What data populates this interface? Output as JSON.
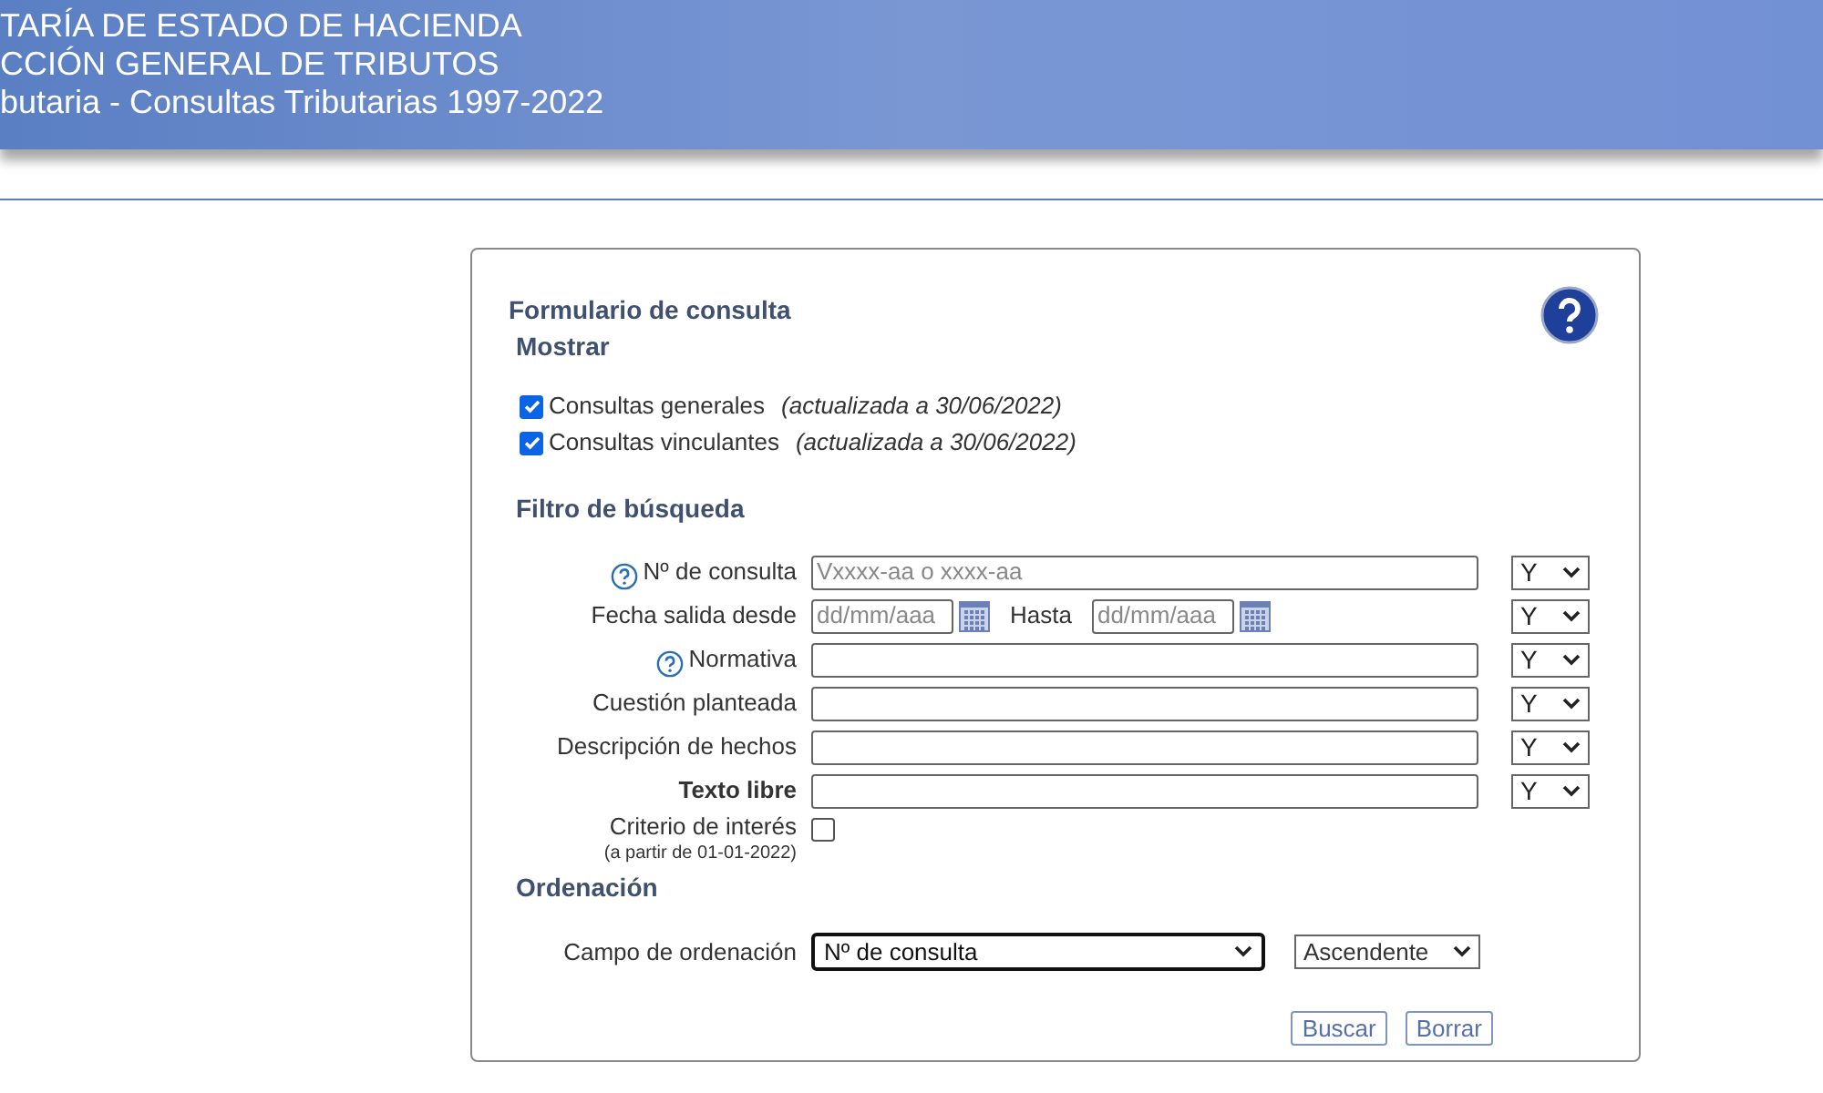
{
  "header": {
    "lines": [
      "TARÍA DE ESTADO DE HACIENDA",
      "CCIÓN GENERAL DE TRIBUTOS",
      "butaria - Consultas Tributarias 1997-2022"
    ]
  },
  "form": {
    "title": "Formulario de consulta",
    "show": {
      "heading": "Mostrar",
      "options": [
        {
          "label": "Consultas generales",
          "note": "(actualizada a 30/06/2022)",
          "checked": true
        },
        {
          "label": "Consultas vinculantes",
          "note": "(actualizada a 30/06/2022)",
          "checked": true
        }
      ]
    },
    "filter": {
      "heading": "Filtro de búsqueda",
      "fields": [
        {
          "kind": "text",
          "label": "Nº de consulta",
          "help": true,
          "bold": false,
          "placeholder": "Vxxxx-aa o xxxx-aa",
          "operator": "Y"
        },
        {
          "kind": "date",
          "label": "Fecha salida desde",
          "help": false,
          "bold": false,
          "placeholder": "dd/mm/aaa",
          "to_label": "Hasta",
          "to_placeholder": "dd/mm/aaa",
          "operator": "Y"
        },
        {
          "kind": "text",
          "label": "Normativa",
          "help": true,
          "bold": false,
          "operator": "Y"
        },
        {
          "kind": "text",
          "label": "Cuestión planteada",
          "help": false,
          "bold": false,
          "operator": "Y"
        },
        {
          "kind": "text",
          "label": "Descripción de hechos",
          "help": false,
          "bold": false,
          "operator": "Y"
        },
        {
          "kind": "text",
          "label": "Texto libre",
          "help": false,
          "bold": true,
          "operator": "Y"
        },
        {
          "kind": "check",
          "label": "Criterio de interés",
          "sublabel": "(a partir de 01-01-2022)",
          "checked": false
        }
      ]
    },
    "order": {
      "heading": "Ordenación",
      "label": "Campo de ordenación",
      "field": "Nº de consulta",
      "direction": "Ascendente"
    },
    "buttons": [
      "Buscar",
      "Borrar"
    ]
  }
}
